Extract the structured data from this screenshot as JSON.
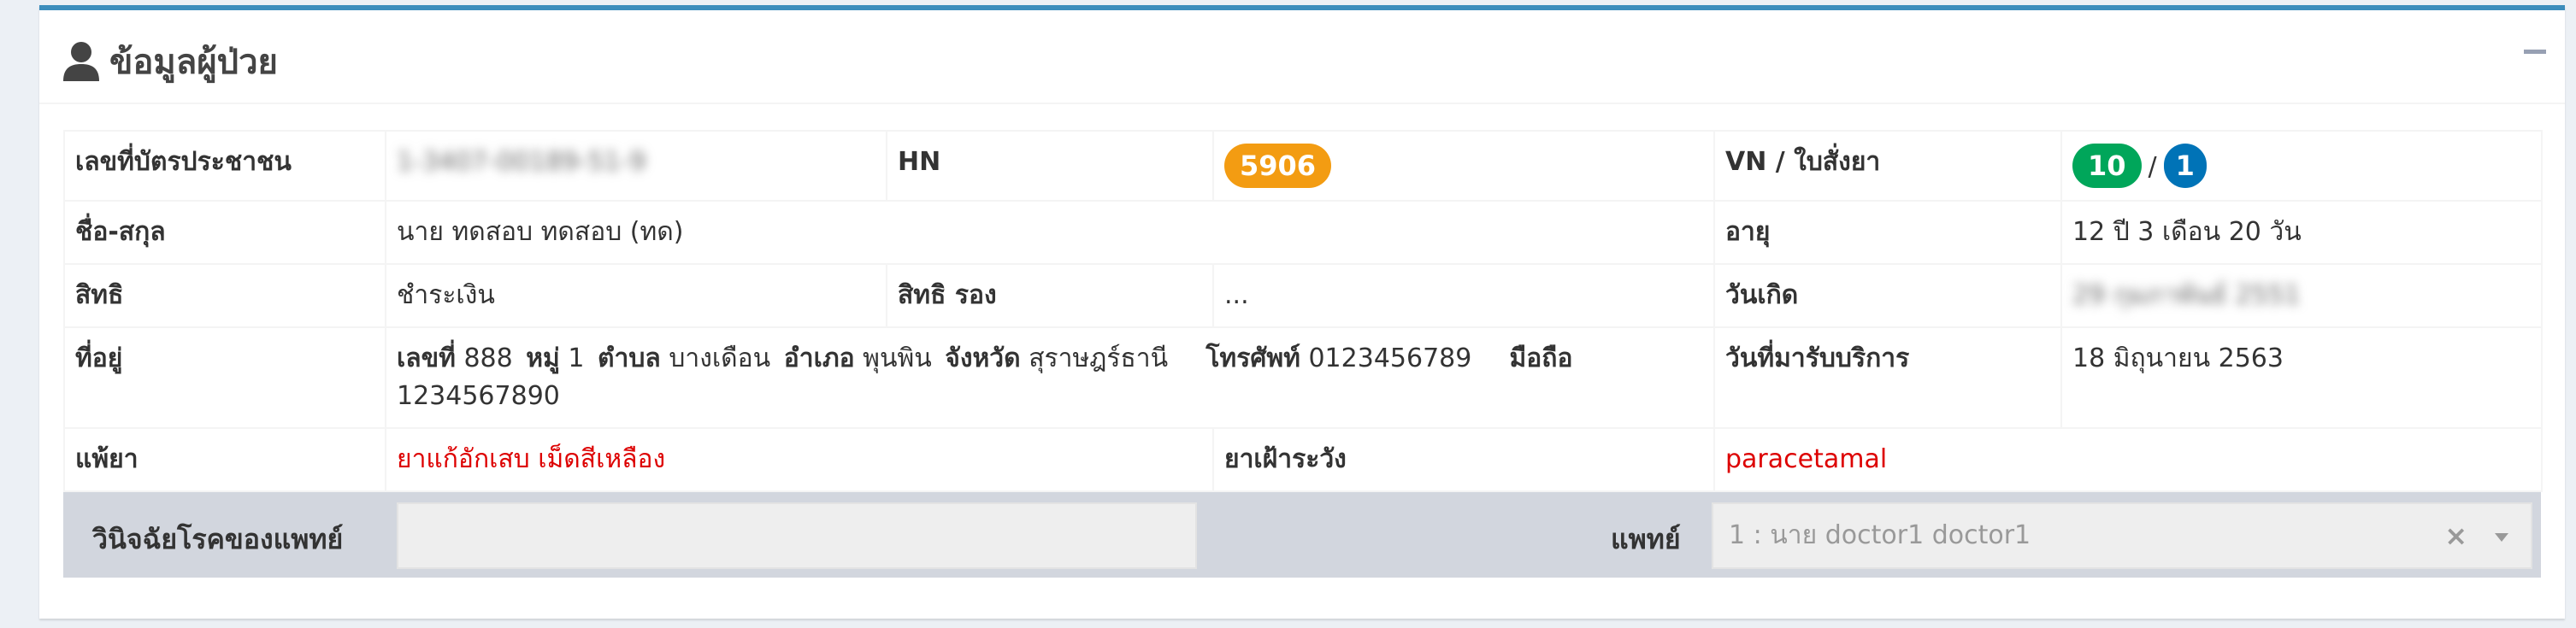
{
  "panel": {
    "title": "ข้อมูลผู้ป่วย"
  },
  "labels": {
    "citizen_id": "เลขที่บัตรประชาชน",
    "hn": "HN",
    "vn": "VN / ใบสั่งยา",
    "name": "ชื่อ-สกุล",
    "age": "อายุ",
    "right": "สิทธิ",
    "secondary_right": "สิทธิ รอง",
    "birthdate": "วันเกิด",
    "address": "ที่อยู่",
    "service_date": "วันที่มารับบริการ",
    "allergy": "แพ้ยา",
    "caution_drug": "ยาเฝ้าระวัง",
    "diagnosis": "วินิจฉัยโรคของแพทย์",
    "doctor": "แพทย์"
  },
  "patient": {
    "citizen_id": "1-3407-00189-51-9",
    "hn": "5906",
    "vn": "10",
    "vn_separator": "/",
    "prescription_no": "1",
    "name": "นาย ทดสอบ ทดสอบ (ทด)",
    "age": "12 ปี 3 เดือน 20 วัน",
    "right": "ชำระเงิน",
    "secondary_right": "...",
    "birthdate": "29 กุมภาพันธ์ 2551",
    "service_date": "18 มิถุนายน 2563",
    "allergy": "ยาแก้อักเสบ เม็ดสีเหลือง",
    "caution_drug": "paracetamal"
  },
  "address": {
    "house_no_label": "เลขที่",
    "house_no": "888",
    "moo_label": "หมู่",
    "moo": "1",
    "tambon_label": "ตำบล",
    "tambon": "บางเดือน",
    "amphoe_label": "อำเภอ",
    "amphoe": "พุนพิน",
    "province_label": "จังหวัด",
    "province": "สุราษฎร์ธานี",
    "phone_label": "โทรศัพท์",
    "phone": "0123456789",
    "mobile_label": "มือถือ",
    "mobile": "1234567890"
  },
  "doctor_select": {
    "selected": "1 : นาย doctor1 doctor1",
    "clear_glyph": "×"
  },
  "icons": {
    "user": "user-icon",
    "collapse": "minus-icon"
  },
  "colors": {
    "accent": "#3c8dbc",
    "hn_badge": "#f39c12",
    "vn_badge": "#00a65a",
    "rx_badge": "#0073b7",
    "alert_text": "#dd0000"
  }
}
